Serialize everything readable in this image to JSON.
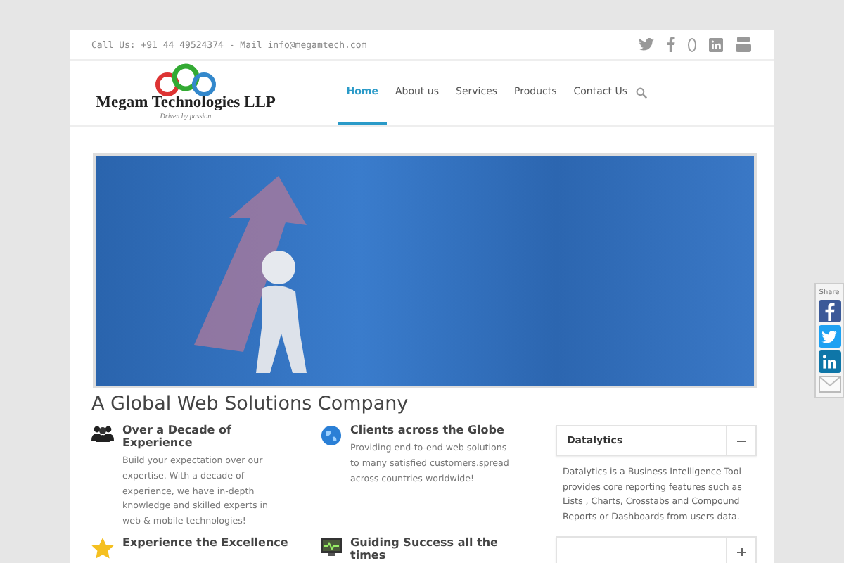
{
  "top_bar": {
    "contact": "Call Us: +91 44 49524374 - Mail info@megamtech.com"
  },
  "logo": {
    "name": "Megam Technologies LLP",
    "tagline": "Driven by passion"
  },
  "nav": [
    {
      "label": "Home",
      "selected": true
    },
    {
      "label": "About us",
      "selected": false
    },
    {
      "label": "Services",
      "selected": false
    },
    {
      "label": "Products",
      "selected": false
    },
    {
      "label": "Contact Us",
      "selected": false
    }
  ],
  "heading": "A Global Web Solutions Company",
  "features": [
    {
      "kind": "people",
      "title": "Over a Decade of Experience",
      "text": "Build your expectation over our expertise. With a decade of experience, we have in-depth knowledge and skilled experts in web & mobile technologies!"
    },
    {
      "kind": "globe",
      "title": "Clients across the Globe",
      "text": "Providing end-to-end web solutions to many satisfied customers.spread across countries worldwide!"
    },
    {
      "kind": "star",
      "title": "Experience the Excellence"
    },
    {
      "kind": "monitor",
      "title": "Guiding Success all the times"
    }
  ],
  "accordion": [
    {
      "title": "Datalytics",
      "expanded": true,
      "text": "Datalytics is a Business Intelligence Tool provides core reporting features such as Lists , Charts, Crosstabs and Compound Reports or Dashboards from users data."
    },
    {
      "expanded": false
    }
  ],
  "share": {
    "label": "Share"
  }
}
